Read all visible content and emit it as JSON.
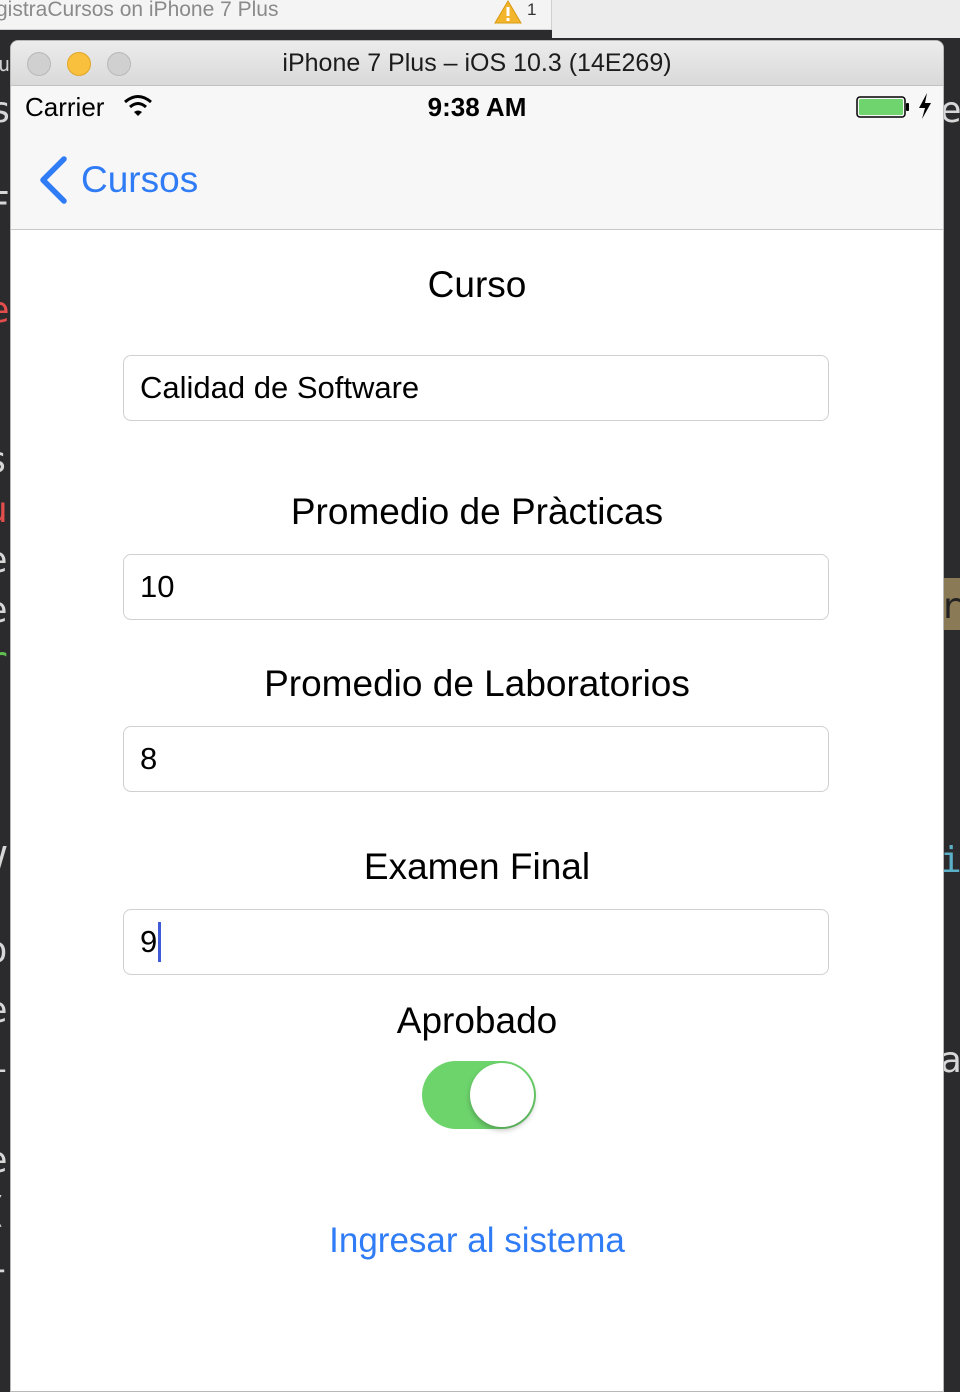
{
  "xcode": {
    "tab_title": "gistraCursos on iPhone 7 Plus",
    "warning_count": "1"
  },
  "simulator": {
    "window_title": "iPhone 7 Plus – iOS 10.3 (14E269)"
  },
  "status_bar": {
    "carrier": "Carrier",
    "time": "9:38 AM",
    "battery_color": "#6fd46e"
  },
  "nav": {
    "back_label": "Cursos",
    "accent_color": "#2f7cf6"
  },
  "form": {
    "curso_label": "Curso",
    "curso_value": "Calidad de Software",
    "practicas_label": "Promedio de Pràcticas",
    "practicas_value": "10",
    "laboratorios_label": "Promedio de Laboratorios",
    "laboratorios_value": "8",
    "examen_label": "Examen Final",
    "examen_value": "9",
    "aprobado_label": "Aprobado",
    "aprobado_on": true,
    "submit_label": "Ingresar al sistema"
  }
}
